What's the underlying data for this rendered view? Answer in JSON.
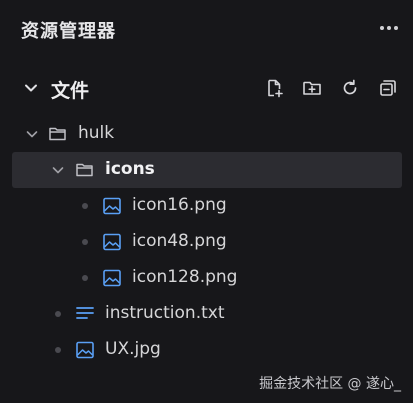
{
  "header": {
    "title": "资源管理器",
    "more_icon": "ellipsis-icon"
  },
  "section": {
    "title": "文件",
    "toolbar": [
      {
        "name": "new-file-button",
        "icon": "new-file-icon"
      },
      {
        "name": "new-folder-button",
        "icon": "new-folder-icon"
      },
      {
        "name": "refresh-button",
        "icon": "refresh-icon"
      },
      {
        "name": "collapse-all-button",
        "icon": "collapse-icon"
      }
    ]
  },
  "tree": [
    {
      "label": "hulk",
      "type": "folder",
      "expanded": true,
      "selected": false
    },
    {
      "label": "icons",
      "type": "folder",
      "expanded": true,
      "selected": true
    },
    {
      "label": "icon16.png",
      "type": "image"
    },
    {
      "label": "icon48.png",
      "type": "image"
    },
    {
      "label": "icon128.png",
      "type": "image"
    },
    {
      "label": "instruction.txt",
      "type": "text"
    },
    {
      "label": "UX.jpg",
      "type": "image"
    }
  ],
  "watermark": "掘金技术社区 @ 遂心_",
  "colors": {
    "background": "#17171a",
    "selected_row": "#2c2c31",
    "image_icon": "#5aa0f5",
    "text_icon": "#5aa0f5"
  }
}
